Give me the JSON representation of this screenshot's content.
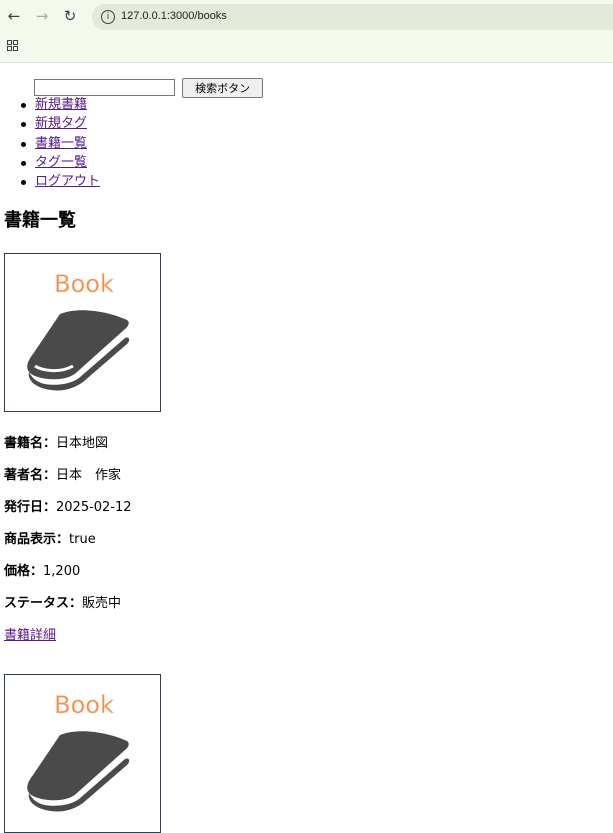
{
  "browser": {
    "url": "127.0.0.1:3000/books"
  },
  "search": {
    "value": "",
    "button_label": "検索ボタン"
  },
  "nav": {
    "items": [
      {
        "label": "新規書籍"
      },
      {
        "label": "新規タグ"
      },
      {
        "label": "書籍一覧"
      },
      {
        "label": "タグ一覧"
      },
      {
        "label": "ログアウト"
      }
    ]
  },
  "page_title": "書籍一覧",
  "books": [
    {
      "image_text": "Book",
      "fields": [
        {
          "label": "書籍名：",
          "value": "日本地図"
        },
        {
          "label": "著者名：",
          "value": "日本　作家"
        },
        {
          "label": "発行日：",
          "value": "2025-02-12"
        },
        {
          "label": "商品表示：",
          "value": "true"
        },
        {
          "label": "価格：",
          "value": "1,200"
        },
        {
          "label": "ステータス：",
          "value": "販売中"
        }
      ],
      "detail_link": "書籍詳細"
    },
    {
      "image_text": "Book"
    }
  ],
  "colors": {
    "link": "#551a8b",
    "book_title_orange": "#f28c4a",
    "book_icon": "#4a4a4a",
    "thumb_border": "#2c3e50"
  }
}
